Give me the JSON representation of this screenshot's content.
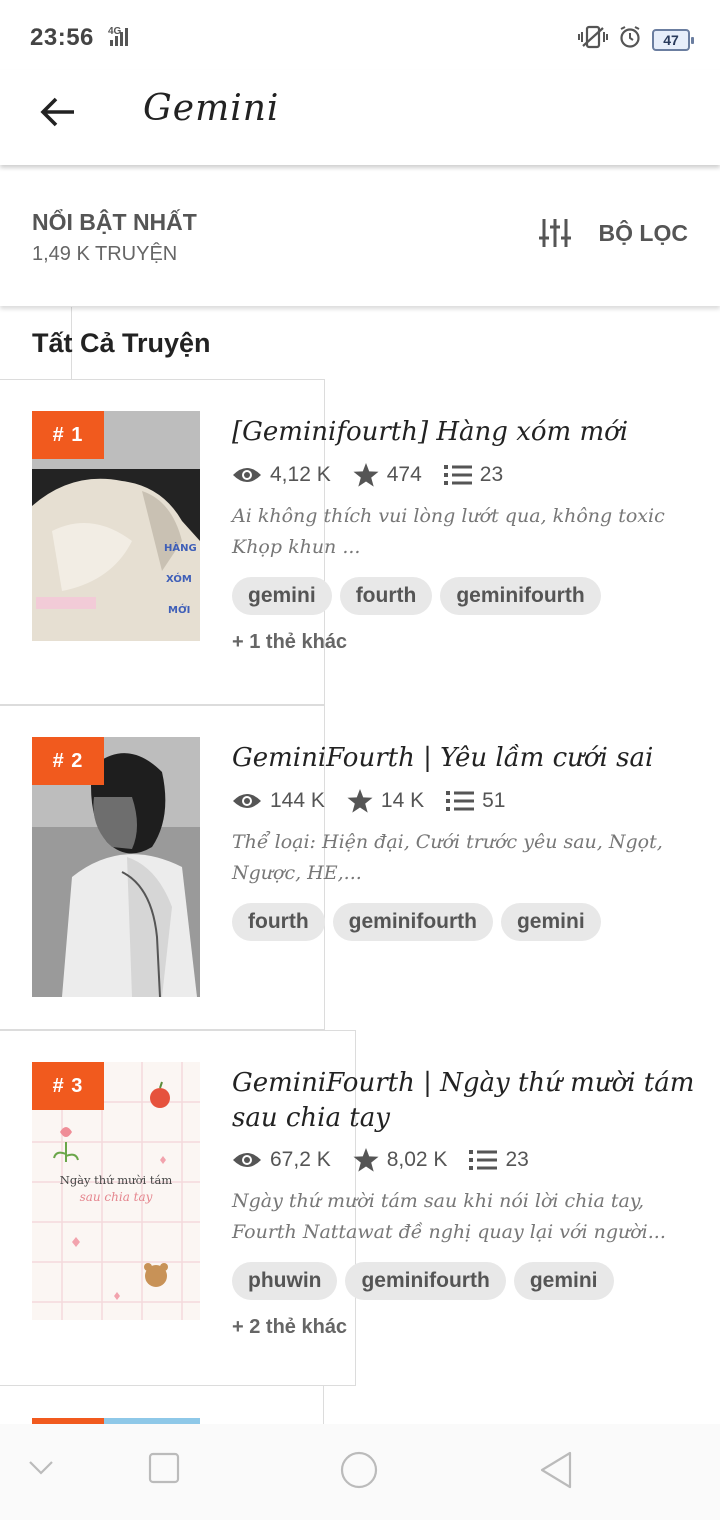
{
  "status": {
    "time": "23:56",
    "network": "4G",
    "battery": "47"
  },
  "app_bar": {
    "title": "Gemini"
  },
  "sort": {
    "title": "NỔI BẬT NHẤT",
    "count": "1,49 K TRUYỆN",
    "filter_label": "BỘ LỌC"
  },
  "section_title": "Tất Cả Truyện",
  "stories": [
    {
      "rank": "# 1",
      "title": "[Geminifourth] Hàng xóm mới",
      "reads": "4,12 K",
      "votes": "474",
      "parts": "23",
      "description": "Ai không thích vui lòng lướt qua, không toxic Khọp khun ...",
      "tags": [
        "gemini",
        "fourth",
        "geminifourth"
      ],
      "more_tags": "+ 1 thẻ khác"
    },
    {
      "rank": "# 2",
      "title": "GeminiFourth | Yêu lầm cưới sai",
      "reads": "144 K",
      "votes": "14 K",
      "parts": "51",
      "description": "Thể loại: Hiện đại, Cưới trước yêu sau, Ngọt, Ngược, HE,...",
      "tags": [
        "fourth",
        "geminifourth",
        "gemini"
      ]
    },
    {
      "rank": "# 3",
      "title": "GeminiFourth | Ngày thứ mười tám sau chia tay",
      "reads": "67,2 K",
      "votes": "8,02 K",
      "parts": "23",
      "description": "Ngày thứ mười tám sau khi nói lời chia tay, Fourth Nattawat đề nghị quay lại với người...",
      "tags": [
        "phuwin",
        "geminifourth",
        "gemini"
      ],
      "more_tags": "+ 2 thẻ khác",
      "cover_text": "Ngày thứ mười tám",
      "cover_subtext": "sau chia tay"
    }
  ]
}
